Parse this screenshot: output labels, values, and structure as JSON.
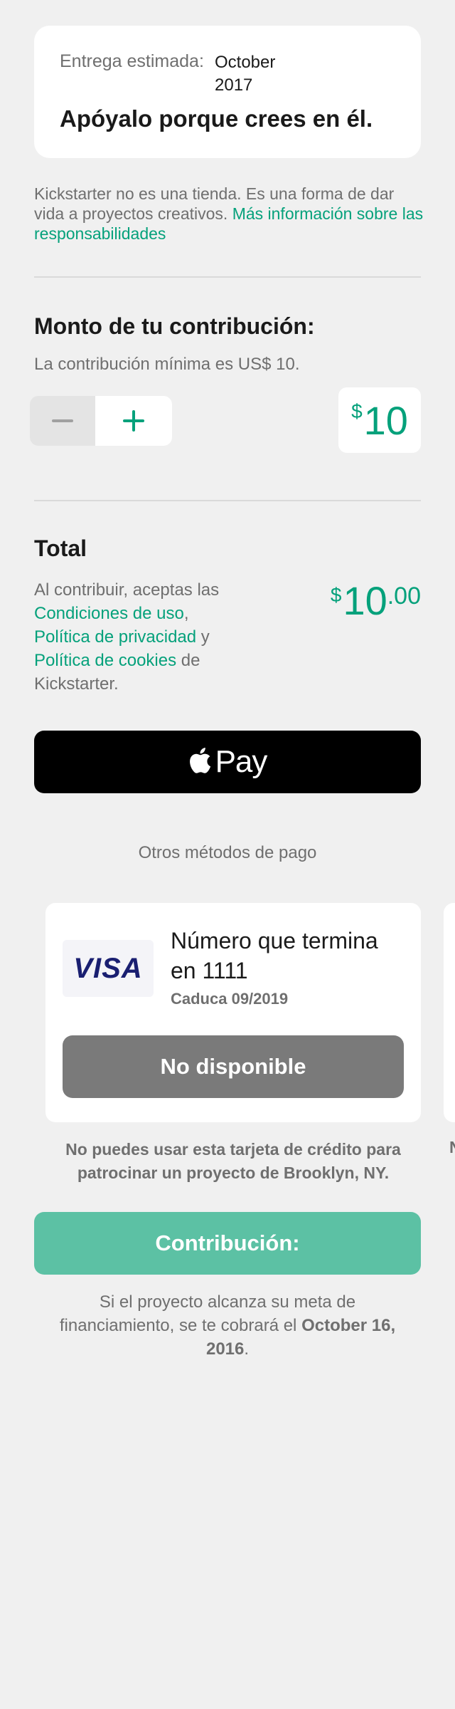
{
  "delivery": {
    "label": "Entrega estimada:",
    "date": "October 2017",
    "tagline": "Apóyalo porque crees en él."
  },
  "disclaimer": {
    "text": "Kickstarter no es una tienda. Es una forma de dar vida a proyectos creativos. ",
    "link": "Más información sobre las responsabilidades"
  },
  "pledge": {
    "title": "Monto de tu contribución:",
    "minimum": "La contribución mínima es US$ 10.",
    "currency_symbol": "$",
    "amount": "10"
  },
  "total": {
    "title": "Total",
    "terms_prefix": "Al contribuir, aceptas las ",
    "terms_link": "Condiciones de uso",
    "comma": ",",
    "privacy_link": "Política de privacidad",
    "and": " y ",
    "cookies_link": "Política de cookies",
    "suffix": " de Kickstarter.",
    "currency_symbol": "$",
    "amount": "10",
    "cents": ".00"
  },
  "apple_pay": {
    "label": "Pay"
  },
  "other_methods": "Otros métodos de pago",
  "card": {
    "brand": "VISA",
    "number_text": "Número que termina en 1111",
    "expiry": "Caduca 09/2019",
    "button_label": "No disponible",
    "warning": "No puedes usar esta tarjeta de crédito para patrocinar un proyecto de Brooklyn, NY.",
    "warning_peek": "N"
  },
  "submit_label": "Contribución:",
  "charge_note": {
    "prefix": "Si el proyecto alcanza su meta de financiamiento, se te cobrará el ",
    "date": "October 16, 2016",
    "suffix": "."
  },
  "colors": {
    "accent": "#05a17b",
    "background": "#f0f0f0",
    "submit_button": "#5cc1a4",
    "disabled_button": "#7a7a7a"
  }
}
